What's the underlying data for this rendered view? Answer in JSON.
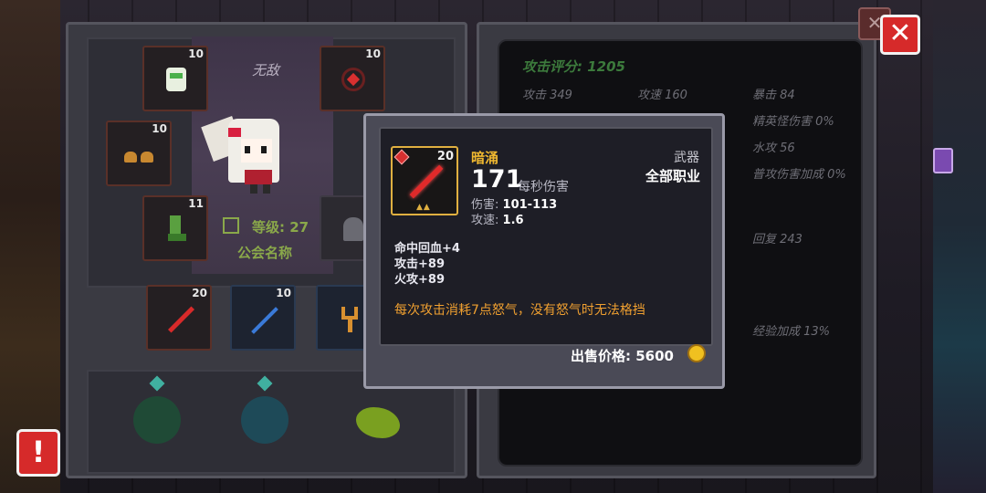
{
  "left_panel": {
    "character_title": "无敌",
    "level_text": "等级: 27",
    "guild_text": "公会名称",
    "slots": [
      {
        "name": "helmet",
        "level": "10",
        "icon": "armor-icon"
      },
      {
        "name": "necklace",
        "level": "10",
        "icon": "amulet-icon"
      },
      {
        "name": "gloves",
        "level": "10",
        "icon": "gloves-icon"
      },
      {
        "name": "boots",
        "level": "11",
        "icon": "boots-icon"
      },
      {
        "name": "weapon",
        "level": "20",
        "icon": "red-sword-icon"
      },
      {
        "name": "staff",
        "level": "10",
        "icon": "blue-staff-icon"
      },
      {
        "name": "slingshot",
        "level": "",
        "icon": "slingshot-icon"
      }
    ]
  },
  "stats_panel": {
    "score": "攻击评分: 1205",
    "stats": [
      {
        "label": "攻击 349"
      },
      {
        "label": "攻速 160"
      },
      {
        "label": "暴击 84"
      },
      {
        "label": "精英怪伤害 0%"
      },
      {
        "label": "水攻 56"
      },
      {
        "label": "普攻伤害加成 0%"
      },
      {
        "label": "回复 243"
      },
      {
        "label": "经验加成 13%"
      }
    ]
  },
  "tooltip": {
    "item_name": "暗涌",
    "item_level": "20",
    "item_type": "武器",
    "item_class": "全部职业",
    "dps_value": "171",
    "dps_label": "每秒伤害",
    "damage_label": "伤害:",
    "damage_value": "101-113",
    "speed_label": "攻速:",
    "speed_value": "1.6",
    "bonuses": [
      "命中回血+4",
      "攻击+89",
      "火攻+89"
    ],
    "special": "每次攻击消耗7点怒气，没有怒气时无法格挡",
    "sell_price": "出售价格: 5600",
    "colors": {
      "name": "#f0b830",
      "special": "#f0a030",
      "border": "#e0b040"
    }
  },
  "buttons": {
    "close": "✕",
    "alert": "!"
  }
}
